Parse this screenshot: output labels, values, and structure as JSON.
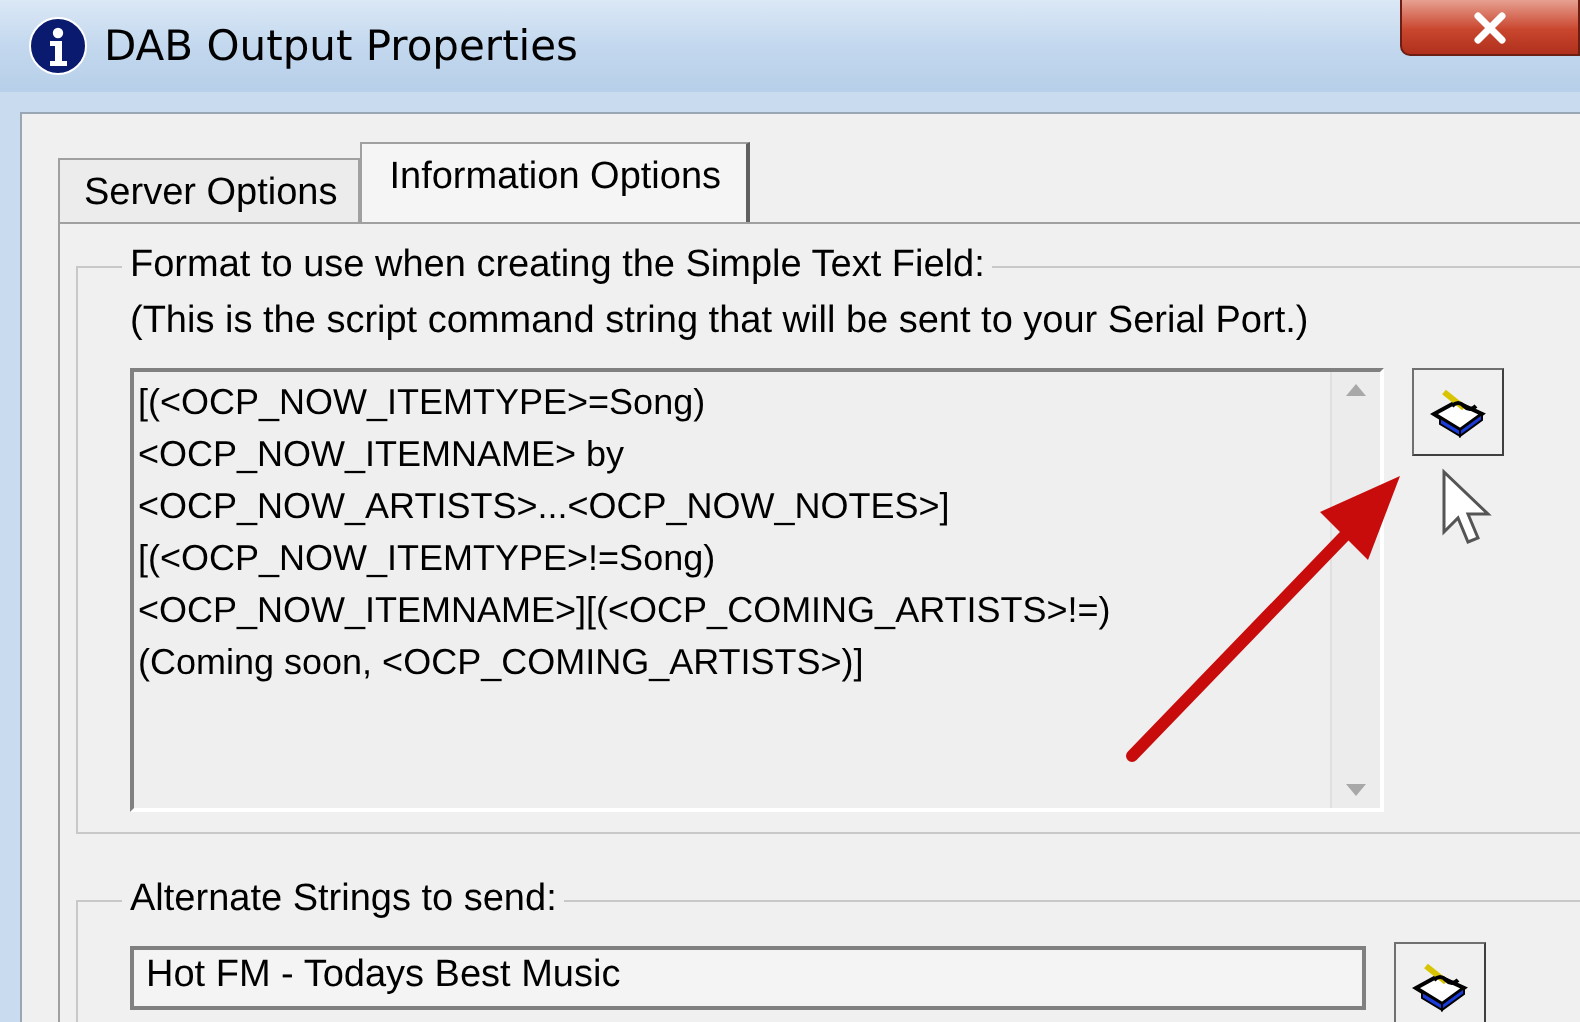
{
  "window": {
    "title": "DAB Output Properties"
  },
  "tabs": [
    {
      "label": "Server Options",
      "selected": false
    },
    {
      "label": "Information Options",
      "selected": true
    }
  ],
  "format_group": {
    "title": "Format to use when creating the Simple Text Field:",
    "description": "(This is the script command string that will be sent to your Serial Port.)",
    "script": "[(<OCP_NOW_ITEMTYPE>=Song)\n<OCP_NOW_ITEMNAME> by\n<OCP_NOW_ARTISTS>...<OCP_NOW_NOTES>]\n[(<OCP_NOW_ITEMTYPE>!=Song)\n<OCP_NOW_ITEMNAME>][(<OCP_COMING_ARTISTS>!=)\n(Coming soon, <OCP_COMING_ARTISTS>)]"
  },
  "alternate_group": {
    "title": "Alternate Strings to send:",
    "value": "Hot FM - Todays Best Music"
  }
}
